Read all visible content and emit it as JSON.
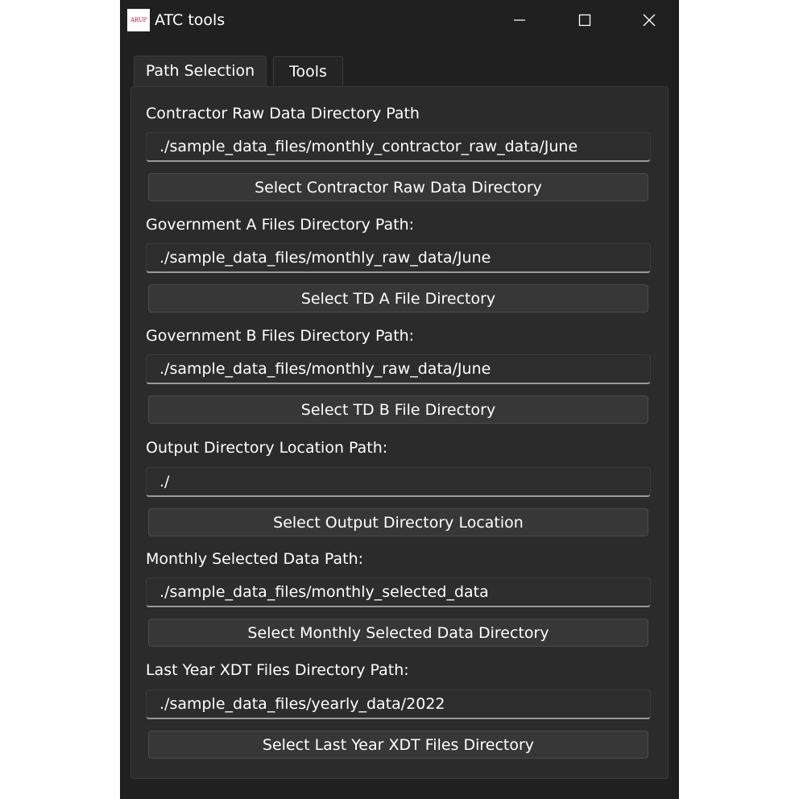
{
  "window": {
    "title": "ATC tools",
    "logo_text": "ARUP",
    "controls": {
      "minimize": "minimize-icon",
      "maximize": "maximize-icon",
      "close": "close-icon"
    }
  },
  "tabs": [
    {
      "label": "Path Selection",
      "selected": true
    },
    {
      "label": "Tools",
      "selected": false
    }
  ],
  "fields": [
    {
      "label": "Contractor Raw Data Directory Path",
      "value": "./sample_data_files/monthly_contractor_raw_data/June",
      "button": "Select Contractor Raw Data Directory"
    },
    {
      "label": "Government A Files Directory Path:",
      "value": "./sample_data_files/monthly_raw_data/June",
      "button": "Select TD A File Directory"
    },
    {
      "label": "Government B Files Directory Path:",
      "value": "./sample_data_files/monthly_raw_data/June",
      "button": "Select TD B File Directory"
    },
    {
      "label": "Output Directory Location Path:",
      "value": "./",
      "button": "Select Output Directory Location"
    },
    {
      "label": "Monthly Selected Data Path:",
      "value": "./sample_data_files/monthly_selected_data",
      "button": "Select Monthly Selected Data Directory"
    },
    {
      "label": "Last Year XDT Files Directory Path:",
      "value": "./sample_data_files/yearly_data/2022",
      "button": "Select Last Year XDT Files Directory"
    }
  ],
  "colors": {
    "window_bg": "#202020",
    "panel_bg": "#2b2b2b",
    "button_bg": "#373737",
    "brand_red": "#c8102e"
  }
}
